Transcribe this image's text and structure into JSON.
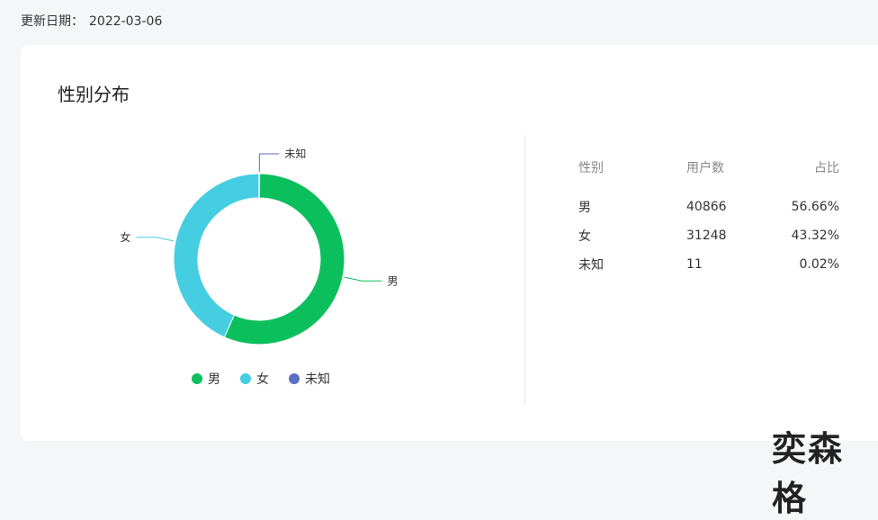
{
  "header": {
    "update_label": "更新日期：",
    "update_date": "2022-03-06"
  },
  "card": {
    "title": "性别分布"
  },
  "colors": {
    "male": "#0bbf5d",
    "female": "#45cde2",
    "unknown": "#5b6fc4"
  },
  "chart_data": {
    "type": "pie",
    "variant": "donut",
    "categories": [
      "男",
      "女",
      "未知"
    ],
    "values": [
      40866,
      31248,
      11
    ],
    "percent": [
      56.66,
      43.32,
      0.02
    ],
    "legend_position": "bottom-center"
  },
  "table": {
    "headers": [
      "性别",
      "用户数",
      "占比"
    ],
    "rows": [
      {
        "gender": "男",
        "users": "40866",
        "ratio": "56.66%"
      },
      {
        "gender": "女",
        "users": "31248",
        "ratio": "43.32%"
      },
      {
        "gender": "未知",
        "users": "11",
        "ratio": "0.02%"
      }
    ]
  },
  "watermark": "奕森格"
}
